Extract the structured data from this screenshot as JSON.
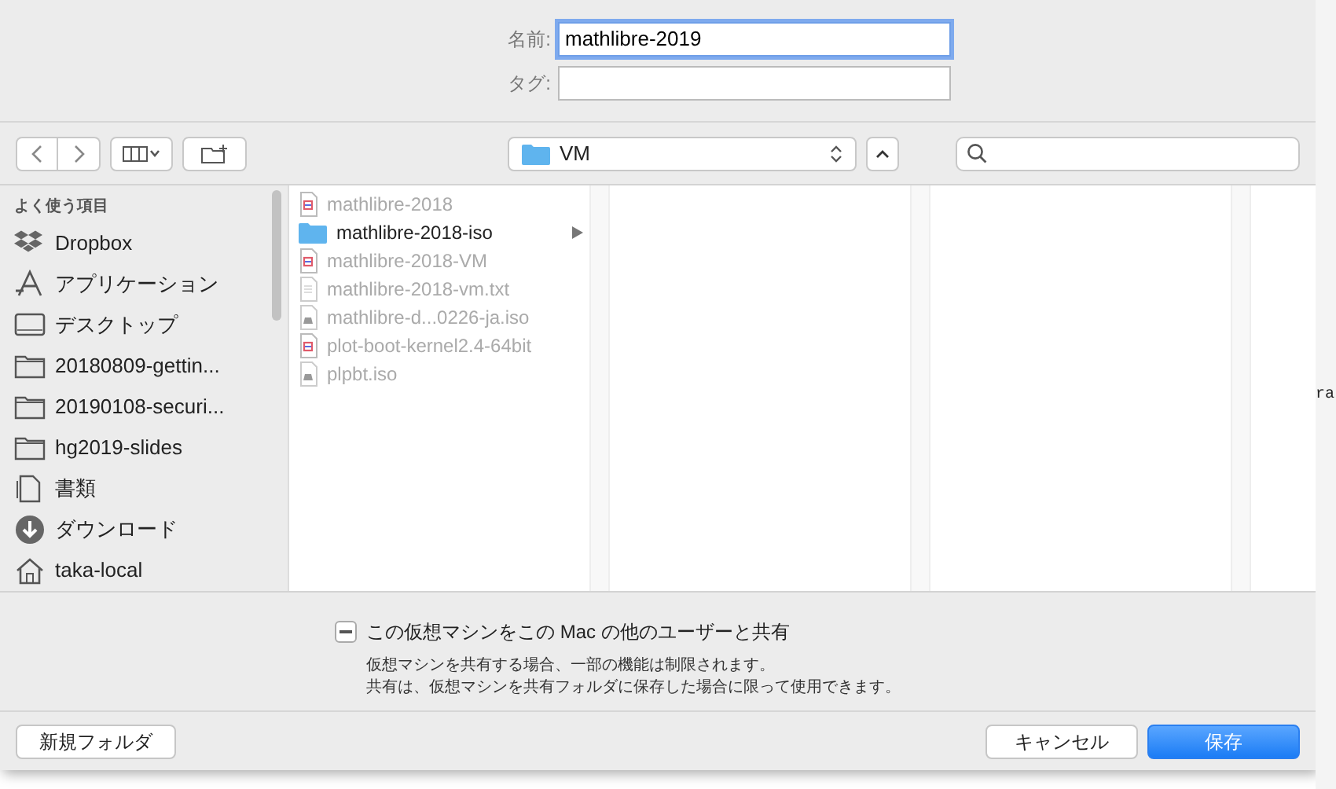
{
  "name_field": {
    "label": "名前:",
    "value": "mathlibre-2019",
    "focused": true
  },
  "tag_field": {
    "label": "タグ:"
  },
  "toolbar": {
    "location": "VM"
  },
  "sidebar": {
    "section": "よく使う項目",
    "items": [
      {
        "label": "Dropbox",
        "kind": "dropbox"
      },
      {
        "label": "アプリケーション",
        "kind": "apps"
      },
      {
        "label": "デスクトップ",
        "kind": "desktop"
      },
      {
        "label": "20180809-gettin...",
        "kind": "folder"
      },
      {
        "label": "20190108-securi...",
        "kind": "folder"
      },
      {
        "label": "hg2019-slides",
        "kind": "folder"
      },
      {
        "label": "書類",
        "kind": "documents"
      },
      {
        "label": "ダウンロード",
        "kind": "downloads"
      },
      {
        "label": "taka-local",
        "kind": "home"
      }
    ]
  },
  "files": [
    {
      "name": "mathlibre-2018",
      "kind": "vm",
      "disabled": true,
      "has_children": false
    },
    {
      "name": "mathlibre-2018-iso",
      "kind": "folder",
      "disabled": false,
      "has_children": true
    },
    {
      "name": "mathlibre-2018-VM",
      "kind": "vm",
      "disabled": true,
      "has_children": false
    },
    {
      "name": "mathlibre-2018-vm.txt",
      "kind": "text",
      "disabled": true,
      "has_children": false
    },
    {
      "name": "mathlibre-d...0226-ja.iso",
      "kind": "disk",
      "disabled": true,
      "has_children": false
    },
    {
      "name": "plot-boot-kernel2.4-64bit",
      "kind": "vm",
      "disabled": true,
      "has_children": false
    },
    {
      "name": "plpbt.iso",
      "kind": "disk",
      "disabled": true,
      "has_children": false
    }
  ],
  "share_option": {
    "label": "この仮想マシンをこの Mac の他のユーザーと共有",
    "mixed": true,
    "notes": [
      "仮想マシンを共有する場合、一部の機能は制限されます。",
      "共有は、仮想マシンを共有フォルダに保存した場合に限って使用できます。"
    ]
  },
  "buttons": {
    "new_folder": "新規フォルダ",
    "cancel": "キャンセル",
    "save": "保存"
  },
  "background_window": {
    "text": "ra"
  }
}
